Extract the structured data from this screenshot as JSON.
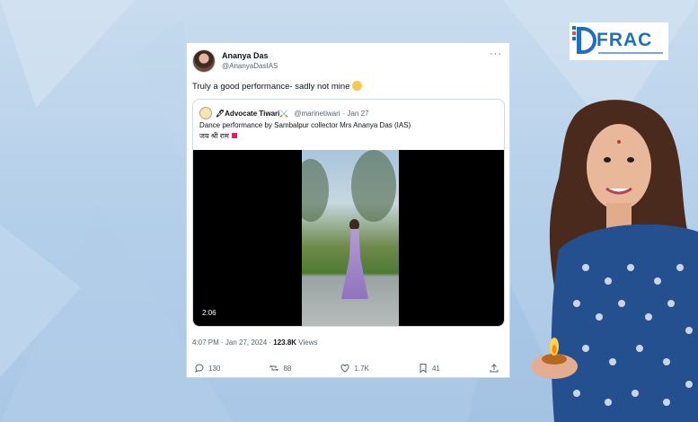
{
  "tweet": {
    "author_name": "Ananya Das",
    "author_handle": "@AnanyaDasIAS",
    "more_label": "···",
    "text": "Truly a good performance- sadly not mine",
    "quote": {
      "author_name": "🖋Advocate Tiwari⚔️",
      "author_handle": "@marinetiwari",
      "date": "· Jan 27",
      "text_line1": "Dance performance by Sambalpur collector Mrs Ananya Das (IAS)",
      "text_line2": "जय श्री राम",
      "video_duration": "2:06"
    },
    "timestamp": "4:07 PM · Jan 27, 2024 · ",
    "views_count": "123.8K",
    "views_label": " Views",
    "actions": {
      "replies": "130",
      "reposts": "88",
      "likes": "1.7K",
      "bookmarks": "41"
    }
  },
  "logo": {
    "text": "FRAC"
  },
  "colors": {
    "accent": "#1f6fbf",
    "text": "#0f1419",
    "muted": "#536471"
  }
}
